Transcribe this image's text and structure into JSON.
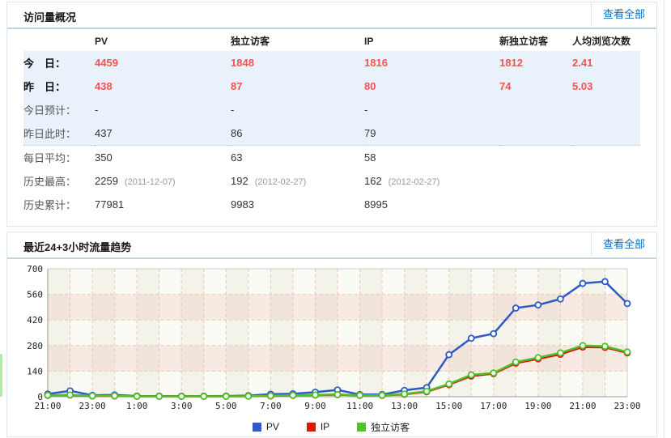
{
  "colors": {
    "pv": "#2e59c7",
    "ip": "#dd1505",
    "visitors": "#4cc32a",
    "highlight_value": "#f95050",
    "link": "#0a6fc2",
    "row_highlight_bg": "#e9f2fb"
  },
  "overview": {
    "title": "访问量概况",
    "view_all_label": "查看全部",
    "columns": [
      "PV",
      "独立访客",
      "IP",
      "新独立访客",
      "人均浏览次数"
    ],
    "rows": [
      {
        "label": "今　日：",
        "values": [
          "4459",
          "1848",
          "1816",
          "1812",
          "2.41"
        ],
        "emphasis": true,
        "highlight": true
      },
      {
        "label": "昨　日：",
        "values": [
          "438",
          "87",
          "80",
          "74",
          "5.03"
        ],
        "emphasis": true,
        "highlight": true
      },
      {
        "label": "今日预计：",
        "values": [
          "-",
          "-",
          "-",
          "",
          ""
        ],
        "highlight": true
      },
      {
        "label": "昨日此时：",
        "values": [
          "437",
          "86",
          "79",
          "",
          ""
        ],
        "highlight": true,
        "divider_after": true
      },
      {
        "label": "每日平均：",
        "values": [
          "350",
          "63",
          "58",
          "",
          ""
        ]
      },
      {
        "label": "历史最高：",
        "values": [
          "2259",
          "192",
          "162",
          "",
          ""
        ],
        "notes": [
          "(2011-12-07)",
          "(2012-02-27)",
          "(2012-02-27)",
          "",
          ""
        ]
      },
      {
        "label": "历史累计：",
        "values": [
          "77981",
          "9983",
          "8995",
          "",
          ""
        ]
      }
    ]
  },
  "trend": {
    "title": "最近24+3小时流量趋势",
    "view_all_label": "查看全部"
  },
  "chart_data": {
    "type": "line",
    "title": "最近24+3小时流量趋势",
    "x": [
      "21:00",
      "22:00",
      "23:00",
      "0:00",
      "1:00",
      "2:00",
      "3:00",
      "4:00",
      "5:00",
      "6:00",
      "7:00",
      "8:00",
      "9:00",
      "10:00",
      "11:00",
      "12:00",
      "13:00",
      "14:00",
      "15:00",
      "16:00",
      "17:00",
      "18:00",
      "19:00",
      "20:00",
      "21:00",
      "22:00",
      "23:00"
    ],
    "x_tick_every": 2,
    "ylim": [
      0,
      700
    ],
    "yticks": [
      0,
      140,
      280,
      420,
      560,
      700
    ],
    "grid": true,
    "legend_position": "bottom",
    "series": [
      {
        "name": "PV",
        "color": "#2e59c7",
        "values": [
          15,
          32,
          8,
          10,
          4,
          3,
          3,
          3,
          4,
          6,
          14,
          16,
          25,
          37,
          12,
          12,
          35,
          50,
          230,
          320,
          345,
          485,
          502,
          535,
          620,
          630,
          510
        ]
      },
      {
        "name": "IP",
        "color": "#dd1505",
        "values": [
          7,
          9,
          4,
          4,
          2,
          2,
          2,
          2,
          2,
          3,
          4,
          7,
          9,
          11,
          7,
          7,
          13,
          27,
          66,
          113,
          126,
          184,
          207,
          232,
          272,
          270,
          240
        ]
      },
      {
        "name": "独立访客",
        "color": "#4cc32a",
        "values": [
          8,
          10,
          5,
          5,
          2,
          2,
          2,
          2,
          2,
          3,
          5,
          8,
          10,
          12,
          8,
          8,
          15,
          30,
          70,
          120,
          130,
          190,
          214,
          240,
          280,
          276,
          245
        ]
      }
    ]
  }
}
